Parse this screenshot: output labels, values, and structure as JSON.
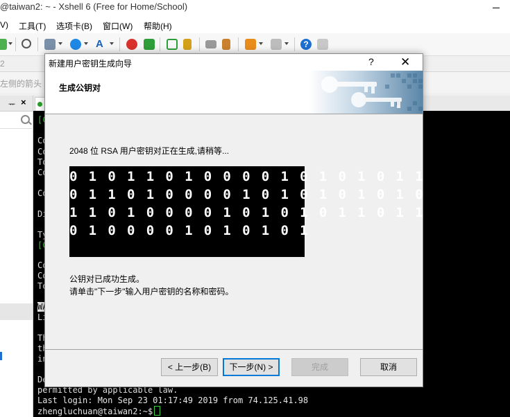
{
  "app": {
    "title": "@taiwan2: ~ - Xshell 6 (Free for Home/School)"
  },
  "menu": [
    {
      "label": "V)"
    },
    {
      "label": "工具(T)"
    },
    {
      "label": "选项卡(B)"
    },
    {
      "label": "窗口(W)"
    },
    {
      "label": "帮助(H)"
    }
  ],
  "address_bar": {
    "text": "2"
  },
  "hint_bar": {
    "text": "左侧的箭头"
  },
  "terminal": {
    "lines": [
      {
        "text": "[C",
        "style": "green"
      },
      {
        "text": "Co",
        "style": ""
      },
      {
        "text": "Co",
        "style": ""
      },
      {
        "text": "To",
        "style": ""
      },
      {
        "text": "Co",
        "style": ""
      },
      {
        "text": "Co",
        "style": ""
      },
      {
        "text": "Di",
        "style": ""
      },
      {
        "text": "Ty",
        "style": ""
      },
      {
        "text": "[C",
        "style": "green"
      },
      {
        "text": "Co",
        "style": ""
      },
      {
        "text": "Co",
        "style": ""
      },
      {
        "text": "To",
        "style": ""
      },
      {
        "text": "WA",
        "style": "inv"
      },
      {
        "text": "Li",
        "style": ""
      },
      {
        "text": "Th",
        "style": ""
      },
      {
        "text": "th",
        "style": ""
      },
      {
        "text": "in",
        "style": ""
      },
      {
        "text": "De",
        "style": ""
      },
      {
        "text": "permitted by applicable law.",
        "style": ""
      },
      {
        "text": "Last login: Mon Sep 23 01:17:49 2019 from 74.125.41.98",
        "style": ""
      },
      {
        "text": "zhengluchuan@taiwan2:~$",
        "style": ""
      }
    ]
  },
  "dialog": {
    "title": "新建用户密钥生成向导",
    "help": "?",
    "close": "✕",
    "header_title": "生成公钥对",
    "status": "2048 位 RSA 用户密钥对正在生成,请稍等...",
    "bits": [
      "0101101000010101011",
      "0110100001010101010",
      "1101000010101011011",
      "0100001010101"
    ],
    "message_line1": "公钥对已成功生成。",
    "message_line2": "请单击\"下一步\"输入用户密钥的名称和密码。",
    "buttons": {
      "back": "< 上一步(B)",
      "next": "下一步(N) >",
      "finish": "完成",
      "cancel": "取消"
    }
  },
  "colors": {
    "terminal_bg": "#000000",
    "terminal_green": "#3ccf3c",
    "focus_blue": "#0078d7"
  }
}
